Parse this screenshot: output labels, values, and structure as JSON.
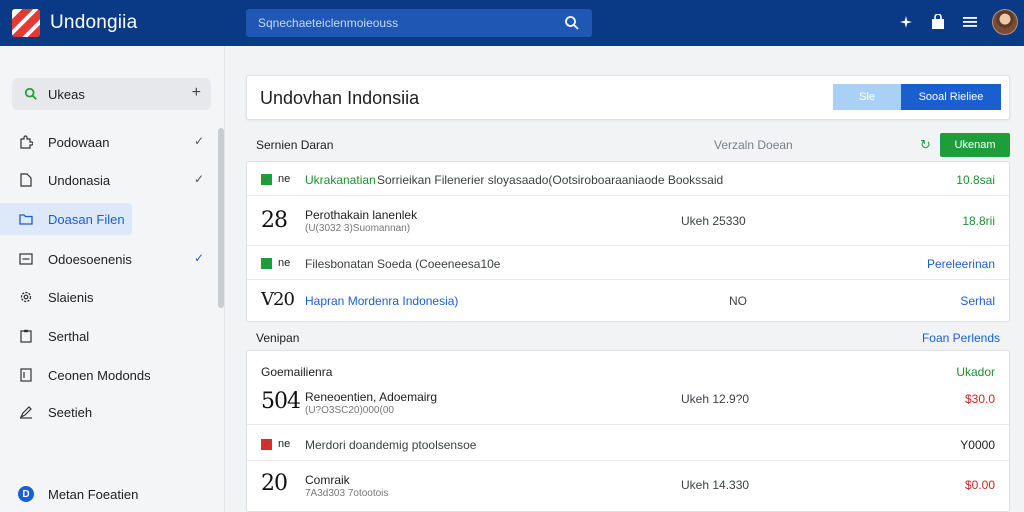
{
  "header": {
    "brand": "Undongiia",
    "search_placeholder": "Sqnechaeteiclenmoieouss",
    "icons": [
      "sparkle-icon",
      "bag-icon",
      "menu-icon",
      "avatar"
    ]
  },
  "sidebar": {
    "search_label": "Ukeas",
    "items": [
      {
        "label": "Podowaan",
        "icon": "puzzle-icon"
      },
      {
        "label": "Undonasia",
        "icon": "file-icon"
      },
      {
        "label": "Doasan Filen",
        "icon": "folder-icon",
        "active": true
      },
      {
        "label": "Odoesoenenis",
        "icon": "list-icon"
      },
      {
        "label": "Slaienis",
        "icon": "gear-icon"
      },
      {
        "label": "Serthal",
        "icon": "clipboard-icon"
      },
      {
        "label": "Ceonen Modonds",
        "icon": "doc-icon"
      },
      {
        "label": "Seetieh",
        "icon": "pen-icon"
      }
    ],
    "footer_label": "Metan Foeatien"
  },
  "main": {
    "title": "Undovhan Indonsiia",
    "btn_light": "Sle",
    "btn_primary": "Sooal Rieliee",
    "section1": {
      "title": "Sernien Daran",
      "mid": "Verzaln Doean",
      "button": "Ukenam",
      "rows": [
        {
          "tag": "ne",
          "text": "Ukrakanatian",
          "text2": "Sorrieikan Filenerier sloyasaado(Ootsiroboaraaniaode Bookssaid",
          "right": "10.8sai"
        },
        {
          "num": "28",
          "title": "Perothakain lanenlek",
          "sub": "(U(3032 3)Suomannan)",
          "mid": "Ukeh 25330",
          "right": "18.8rii"
        },
        {
          "tag": "ne",
          "text": "Filesbonatan Soeda (Coeeneesa10e",
          "right": "Pereleerinan"
        },
        {
          "num": "V20",
          "title": "Hapran Mordenra Indonesia)",
          "mid": "NO",
          "right": "Serhal"
        }
      ]
    },
    "section2": {
      "title": "Venipan",
      "right_link": "Foan Perlends",
      "head_title": "Goemailienra",
      "head_right": "Ukador",
      "rows": [
        {
          "num": "504",
          "title": "Reneoentien, Adoemairg",
          "sub": "(U?O3SC20)000(00",
          "mid": "Ukeh 12.9?0",
          "right": "$30.0"
        },
        {
          "tag": "ne",
          "text": "Merdori doandemig ptoolsensoe",
          "right": "Y0000"
        },
        {
          "num": "20",
          "title": "Comraik",
          "sub": "7A3d303 7otootois",
          "mid": "Ukeh 14.330",
          "right": "$0.00"
        }
      ]
    }
  },
  "colors": {
    "header": "#0a3a86",
    "primary": "#1a5fd0",
    "success": "#1e9e3a",
    "danger": "#c62828"
  }
}
